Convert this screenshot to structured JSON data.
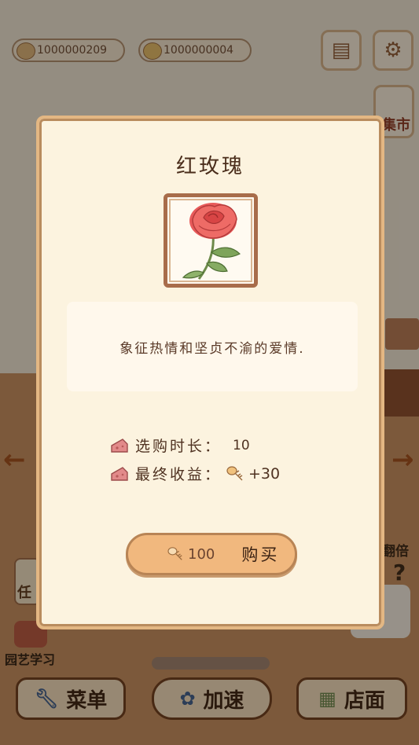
{
  "hud": {
    "fish_currency": "1000000209",
    "cheese_currency": "1000000004",
    "market_label": "集市",
    "double_label": "翻倍",
    "task_label": "任",
    "question_mark": "?",
    "garden_label": "园艺学习"
  },
  "bottom_bar": {
    "menu_label": "菜单",
    "speed_label": "加速",
    "shop_label": "店面"
  },
  "dialog": {
    "title": "红玫瑰",
    "description": "象征热情和坚贞不渝的爱情.",
    "stats": [
      {
        "label": "选购时长：",
        "value": "10"
      },
      {
        "label": "最终收益：",
        "value": "+30"
      }
    ],
    "buy": {
      "price": "100",
      "label": "购买"
    }
  },
  "colors": {
    "accent": "#f1b87e",
    "frame": "#a86c4a",
    "dialog_bg": "#fcf3df"
  }
}
